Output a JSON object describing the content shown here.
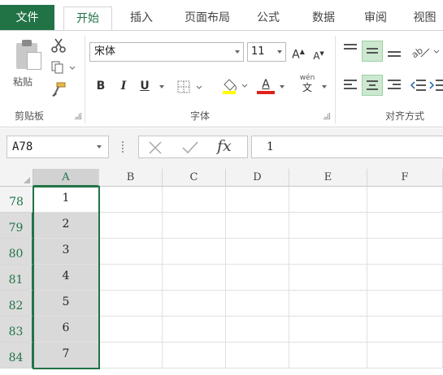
{
  "tabs": [
    {
      "label": "文件"
    },
    {
      "label": "开始"
    },
    {
      "label": "插入"
    },
    {
      "label": "页面布局"
    },
    {
      "label": "公式"
    },
    {
      "label": "数据"
    },
    {
      "label": "审阅"
    },
    {
      "label": "视图"
    }
  ],
  "ribbon": {
    "clipboard": {
      "paste_label": "粘贴",
      "group_label": "剪贴板"
    },
    "font": {
      "font_name": "宋体",
      "font_size": "11",
      "grow_label": "A",
      "shrink_label": "A",
      "bold_label": "B",
      "italic_label": "I",
      "underline_label": "U",
      "font_color_label": "A",
      "phonetic_top": "wén",
      "phonetic_bottom": "文",
      "group_label": "字体"
    },
    "alignment": {
      "group_label": "对齐方式"
    }
  },
  "formula_bar": {
    "name_box": "A78",
    "formula_value": "1",
    "fx_label": "fx"
  },
  "sheet": {
    "columns": [
      "A",
      "B",
      "C",
      "D",
      "E",
      "F"
    ],
    "rows": [
      {
        "number": "78",
        "a": "1"
      },
      {
        "number": "79",
        "a": "2"
      },
      {
        "number": "80",
        "a": "3"
      },
      {
        "number": "81",
        "a": "4"
      },
      {
        "number": "82",
        "a": "5"
      },
      {
        "number": "83",
        "a": "6"
      },
      {
        "number": "84",
        "a": "7"
      }
    ]
  },
  "colors": {
    "accent": "#217346",
    "selection": "#d9d9d9"
  }
}
